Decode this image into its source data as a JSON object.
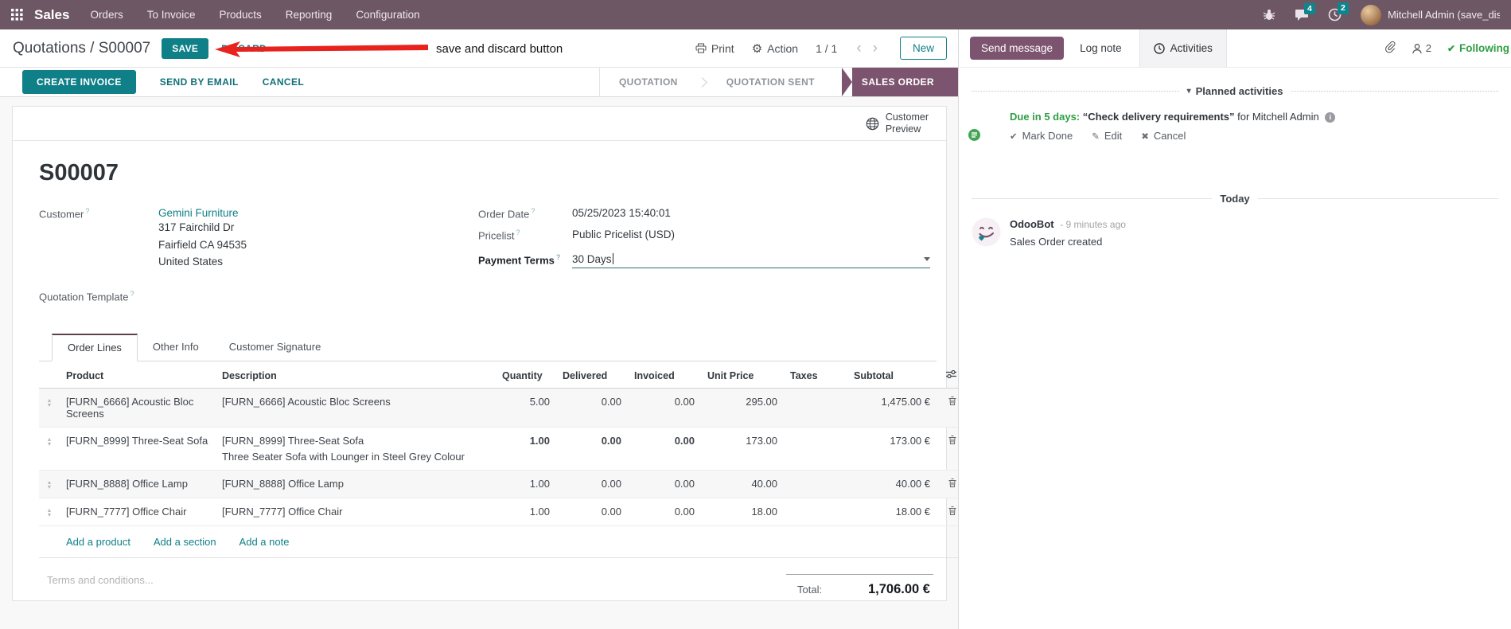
{
  "nav": {
    "app_name": "Sales",
    "menus": [
      "Orders",
      "To Invoice",
      "Products",
      "Reporting",
      "Configuration"
    ],
    "badges": {
      "messages": "4",
      "activities": "2"
    },
    "user_name": "Mitchell Admin (save_discar"
  },
  "control": {
    "breadcrumb": "Quotations / S00007",
    "save": "SAVE",
    "discard": "DISCARD",
    "annotation": "save and discard button",
    "print": "Print",
    "action": "Action",
    "pager": "1 / 1",
    "new": "New"
  },
  "statusbar": {
    "create_invoice": "CREATE INVOICE",
    "send_by_email": "SEND BY EMAIL",
    "cancel": "CANCEL",
    "state_quotation": "QUOTATION",
    "state_sent": "QUOTATION SENT",
    "state_order": "SALES ORDER"
  },
  "sheet": {
    "preview_line1": "Customer",
    "preview_line2": "Preview",
    "title": "S00007",
    "help": "?",
    "customer_label": "Customer",
    "customer_name": "Gemini Furniture",
    "addr1": "317 Fairchild Dr",
    "addr2": "Fairfield CA 94535",
    "addr3": "United States",
    "quotation_template_label": "Quotation Template",
    "order_date_label": "Order Date",
    "order_date": "05/25/2023 15:40:01",
    "pricelist_label": "Pricelist",
    "pricelist": "Public Pricelist (USD)",
    "payment_terms_label": "Payment Terms",
    "payment_terms": "30 Days",
    "tabs": [
      "Order Lines",
      "Other Info",
      "Customer Signature"
    ],
    "table": {
      "headers": {
        "product": "Product",
        "description": "Description",
        "quantity": "Quantity",
        "delivered": "Delivered",
        "invoiced": "Invoiced",
        "unit_price": "Unit Price",
        "taxes": "Taxes",
        "subtotal": "Subtotal"
      },
      "rows": [
        {
          "product": "[FURN_6666] Acoustic Bloc Screens",
          "desc1": "[FURN_6666] Acoustic Bloc Screens",
          "desc2": "",
          "quantity": "5.00",
          "delivered": "0.00",
          "invoiced": "0.00",
          "unit_price": "295.00",
          "taxes": "",
          "subtotal": "1,475.00 €"
        },
        {
          "product": "[FURN_8999] Three-Seat Sofa",
          "desc1": "[FURN_8999] Three-Seat Sofa",
          "desc2": "Three Seater Sofa with Lounger in Steel Grey Colour",
          "quantity": "1.00",
          "delivered": "0.00",
          "invoiced": "0.00",
          "unit_price": "173.00",
          "taxes": "",
          "subtotal": "173.00 €"
        },
        {
          "product": "[FURN_8888] Office Lamp",
          "desc1": "[FURN_8888] Office Lamp",
          "desc2": "",
          "quantity": "1.00",
          "delivered": "0.00",
          "invoiced": "0.00",
          "unit_price": "40.00",
          "taxes": "",
          "subtotal": "40.00 €"
        },
        {
          "product": "[FURN_7777] Office Chair",
          "desc1": "[FURN_7777] Office Chair",
          "desc2": "",
          "quantity": "1.00",
          "delivered": "0.00",
          "invoiced": "0.00",
          "unit_price": "18.00",
          "taxes": "",
          "subtotal": "18.00 €"
        }
      ],
      "add_product": "Add a product",
      "add_section": "Add a section",
      "add_note": "Add a note"
    },
    "terms_placeholder": "Terms and conditions...",
    "total_label": "Total:",
    "total_value": "1,706.00 €"
  },
  "chatter": {
    "send_message": "Send message",
    "log_note": "Log note",
    "activities_btn": "Activities",
    "followers_count": "2",
    "following": "Following",
    "planned_header": "Planned activities",
    "activity": {
      "due": "Due in 5 days:",
      "summary": "“Check delivery requirements”",
      "assignee": "for Mitchell Admin",
      "mark_done": "Mark Done",
      "edit": "Edit",
      "cancel": "Cancel"
    },
    "today": "Today",
    "message": {
      "author": "OdooBot",
      "time": "- 9 minutes ago",
      "body": "Sales Order created"
    }
  },
  "colors": {
    "navbar": "#6d5765",
    "primary_teal": "#0f7f88",
    "accent_purple": "#7d546f",
    "link": "#0f7f88",
    "highlight_blue": "#2780c3",
    "green": "#2f9e44",
    "annotation_red": "#e8231d"
  }
}
